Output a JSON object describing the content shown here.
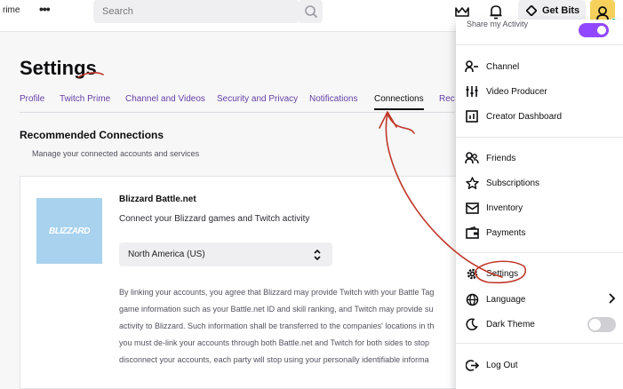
{
  "topbar": {
    "prime_label": "rime",
    "more_label": "•••",
    "search_placeholder": "Search",
    "get_bits_label": "Get Bits"
  },
  "settings": {
    "title": "Settings",
    "tabs": [
      {
        "label": "Profile"
      },
      {
        "label": "Twitch Prime"
      },
      {
        "label": "Channel and Videos"
      },
      {
        "label": "Security and Privacy"
      },
      {
        "label": "Notifications"
      },
      {
        "label": "Connections"
      },
      {
        "label": "Rec"
      }
    ],
    "active_tab": "Connections",
    "section_title": "Recommended Connections",
    "section_subtitle": "Manage your connected accounts and services"
  },
  "connection": {
    "logo_text": "BLIZZARD",
    "name": "Blizzard Battle.net",
    "description": "Connect your Blizzard games and Twitch activity",
    "region_value": "North America (US)",
    "disclaimer_lines": [
      "By linking your accounts, you agree that Blizzard may provide Twitch with your Battle Tag",
      "game information such as your Battle.net ID and skill ranking, and Twitch may provide su",
      "activity to Blizzard. Such information shall be transferred to the companies' locations in th",
      "you must de-link your accounts through both Battle.net and Twitch for both sides to stop",
      "disconnect your accounts, each party will stop using your personally identifiable informa"
    ]
  },
  "dropdown": {
    "top_label": "Share my Activity",
    "items": [
      {
        "label": "Channel",
        "icon": "channel-icon"
      },
      {
        "label": "Video Producer",
        "icon": "video-producer-icon"
      },
      {
        "label": "Creator Dashboard",
        "icon": "dashboard-icon"
      },
      {
        "label": "Friends",
        "icon": "friends-icon"
      },
      {
        "label": "Subscriptions",
        "icon": "star-icon"
      },
      {
        "label": "Inventory",
        "icon": "inventory-icon"
      },
      {
        "label": "Payments",
        "icon": "wallet-icon"
      },
      {
        "label": "Settings",
        "icon": "gear-icon"
      },
      {
        "label": "Language",
        "icon": "globe-icon"
      },
      {
        "label": "Dark Theme",
        "icon": "moon-icon"
      },
      {
        "label": "Log Out",
        "icon": "logout-icon"
      }
    ]
  },
  "colors": {
    "accent": "#6441a4",
    "toggle_on": "#9147ff",
    "annotation": "#c0392b",
    "avatar_bg": "#f5d15c"
  }
}
